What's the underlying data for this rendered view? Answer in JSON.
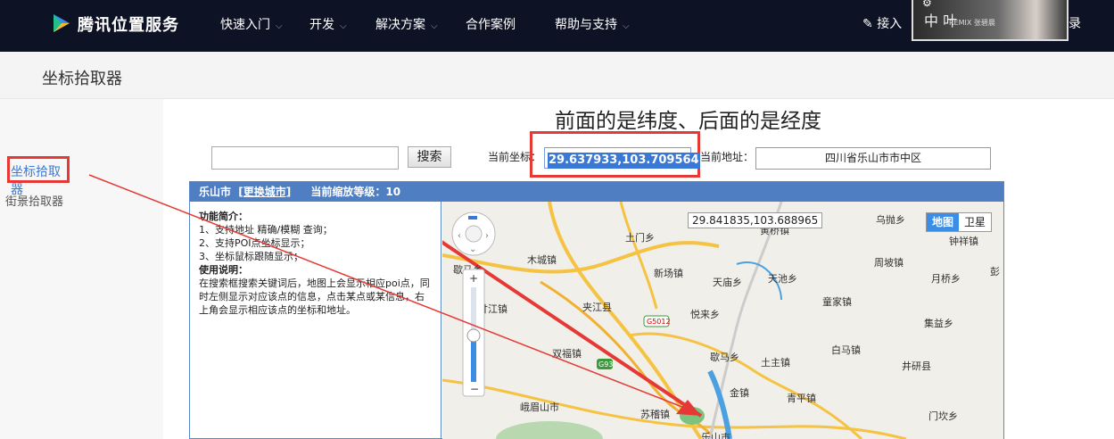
{
  "brand": {
    "name": "腾讯位置服务"
  },
  "nav": {
    "items": [
      {
        "label": "快速入门",
        "chevron": true
      },
      {
        "label": "开发",
        "chevron": true
      },
      {
        "label": "解决方案",
        "chevron": true
      },
      {
        "label": "合作案例",
        "chevron": false
      },
      {
        "label": "帮助与支持",
        "chevron": true
      }
    ],
    "right_partial": "接入",
    "login_partial": "录"
  },
  "ad": {
    "text": "中 叶",
    "subtext": "REMIX 张碧晨"
  },
  "page_title": "坐标拾取器",
  "annotation_title": "前面的是纬度、后面的是经度",
  "left_nav": {
    "active": "坐标拾取器",
    "other": "街景拾取器"
  },
  "search": {
    "value": "",
    "button": "搜索"
  },
  "current_coord": {
    "label": "当前坐标：",
    "value": "29.637933,103.709564"
  },
  "current_addr": {
    "label": "当前地址：",
    "value": "四川省乐山市市中区"
  },
  "panel": {
    "city": "乐山市",
    "change_city": "[更换城市]",
    "zoom_label": "当前缩放等级：10"
  },
  "info": {
    "features_title": "功能简介：",
    "features": [
      "1、支持地址 精确/模糊 查询；",
      "2、支持POI点坐标显示；",
      "3、坐标鼠标跟随显示；"
    ],
    "usage_title": "使用说明：",
    "usage": "在搜索框搜索关键词后，地图上会显示相应poi点，同时左侧显示对应该点的信息，点击某点或某信息，右上角会显示相应该点的坐标和地址。"
  },
  "map": {
    "tooltip": "29.841835,103.688965",
    "type_map": "地图",
    "type_satellite": "卫星",
    "labels": [
      {
        "text": "土门乡"
      },
      {
        "text": "木城镇"
      },
      {
        "text": "新场镇"
      },
      {
        "text": "天庙乡"
      },
      {
        "text": "夹江县"
      },
      {
        "text": "悦来乡"
      },
      {
        "text": "双福镇"
      },
      {
        "text": "峨眉山市"
      },
      {
        "text": "苏稽镇"
      },
      {
        "text": "金镇"
      },
      {
        "text": "土主镇"
      },
      {
        "text": "白马镇"
      },
      {
        "text": "井研县"
      },
      {
        "text": "青平镇"
      },
      {
        "text": "周坡镇"
      },
      {
        "text": "童家镇"
      },
      {
        "text": "集益乡"
      },
      {
        "text": "月桥乡"
      },
      {
        "text": "钟祥镇"
      },
      {
        "text": "乌抛乡"
      },
      {
        "text": "歇马乡"
      },
      {
        "text": "天池乡"
      },
      {
        "text": "门坎乡"
      },
      {
        "text": "乐山市"
      },
      {
        "text": "甘江镇"
      },
      {
        "text": "歇马乡"
      },
      {
        "text": "彭"
      },
      {
        "text": "黄桥镇"
      }
    ],
    "road_badges": [
      "G5012",
      "G93"
    ]
  },
  "colors": {
    "accent": "#e53935",
    "panel": "#4f7fc2",
    "link": "#3a7bd5"
  }
}
